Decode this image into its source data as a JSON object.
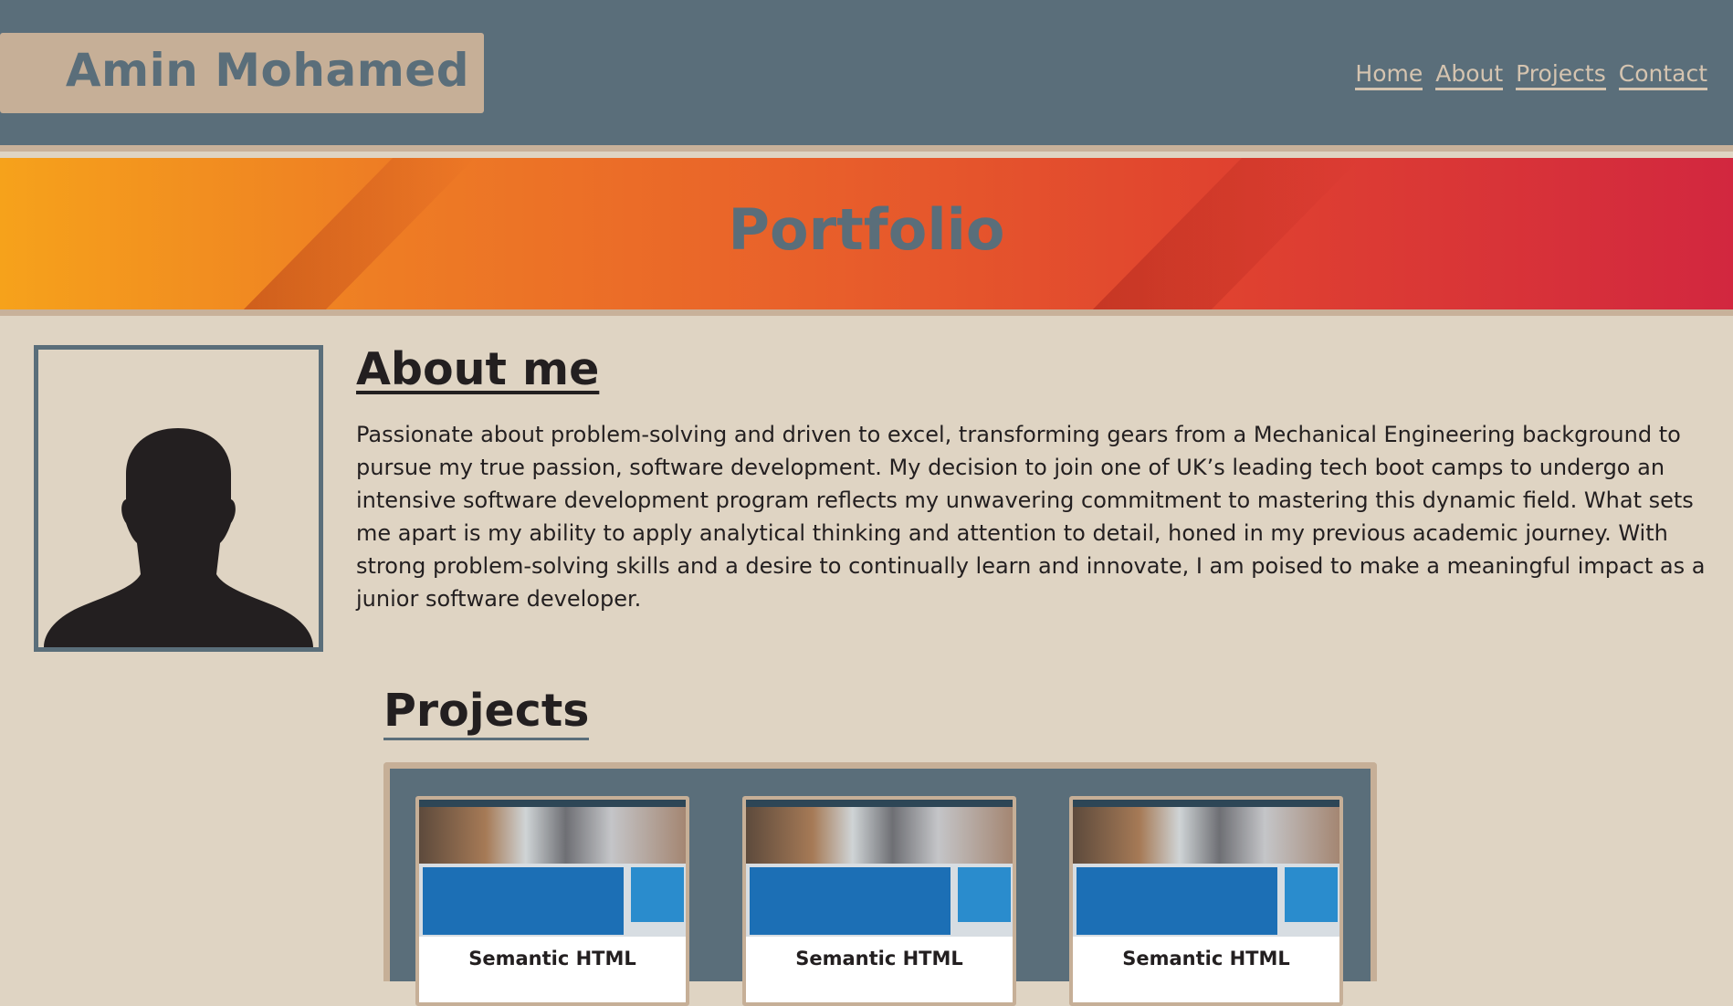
{
  "header": {
    "logo_text": "Amin Mohamed",
    "nav": [
      "Home",
      "About",
      "Projects",
      "Contact"
    ]
  },
  "banner": {
    "title": "Portfolio"
  },
  "about": {
    "title": "About me",
    "text": "Passionate about problem-solving and driven to excel, transforming gears from a Mechanical Engineering background to pursue my true passion, software development. My decision to join one of UK’s leading tech boot camps to undergo an intensive software development program reflects my unwavering commitment to mastering this dynamic field. What sets me apart is my ability to apply analytical thinking and attention to detail, honed in my previous academic journey. With strong problem-solving skills and a desire to continually learn and innovate, I am poised to make a meaningful impact as a junior software developer."
  },
  "projects": {
    "title": "Projects",
    "cards": [
      {
        "label": "Semantic HTML"
      },
      {
        "label": "Semantic HTML"
      },
      {
        "label": "Semantic HTML"
      }
    ]
  },
  "colors": {
    "header_bg": "#5a6e7a",
    "accent_tan": "#c6af97",
    "page_bg": "#dfd4c3",
    "banner_start": "#f6a21b",
    "banner_end": "#d2273f"
  }
}
